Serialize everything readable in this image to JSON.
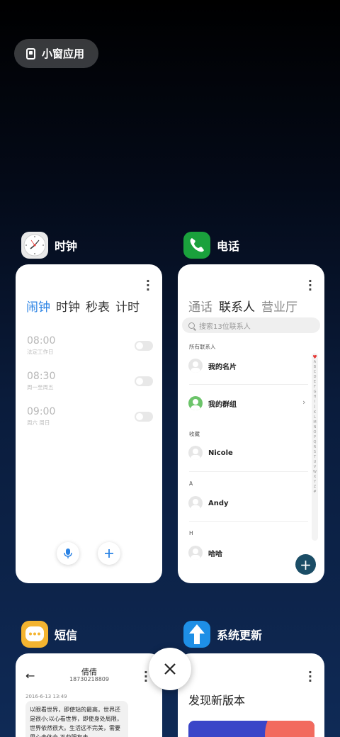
{
  "floating_window": {
    "label": "小窗应用"
  },
  "apps": {
    "clock": {
      "name": "时钟",
      "tabs": [
        "闹钟",
        "时钟",
        "秒表",
        "计时"
      ],
      "active_tab": 0,
      "alarms": [
        {
          "time": "08:00",
          "repeat": "法定工作日"
        },
        {
          "time": "08:30",
          "repeat": "周一至周五"
        },
        {
          "time": "09:00",
          "repeat": "周六 周日"
        }
      ]
    },
    "phone": {
      "name": "电话",
      "tabs": [
        "通话",
        "联系人",
        "营业厅"
      ],
      "active_tab": 1,
      "search_placeholder": "搜索13位联系人",
      "sections": {
        "all_contacts": "所有联系人",
        "favorites": "收藏",
        "a": "A",
        "h": "H"
      },
      "contacts": {
        "my_card": "我的名片",
        "my_groups": "我的群组",
        "nicole": "Nicole",
        "andy": "Andy",
        "haha": "哈哈"
      },
      "index_letters": [
        "♥",
        "A",
        "B",
        "C",
        "D",
        "E",
        "F",
        "G",
        "H",
        "I",
        "J",
        "K",
        "L",
        "M",
        "N",
        "O",
        "P",
        "Q",
        "R",
        "S",
        "T",
        "U",
        "V",
        "W",
        "X",
        "Y",
        "Z",
        "#"
      ]
    },
    "messages": {
      "name": "短信",
      "contact_name": "倩倩",
      "contact_number": "18730218809",
      "date": "2016-6-13 13:49",
      "message": "以眼看世界，即使站的最高，世界还是很小;以心看世界，即使身处局限，世界依然很大。生活远不完美，需要用心去体会,正曲眼有未"
    },
    "system_update": {
      "name": "系统更新",
      "title": "发现新版本"
    }
  },
  "colors": {
    "clock_accent": "#2a82e4",
    "phone_icon": "#1aa13c",
    "messages_icon": "#f4b430",
    "update_icon": "#1e8fe6",
    "fab": "#1b4d66"
  }
}
